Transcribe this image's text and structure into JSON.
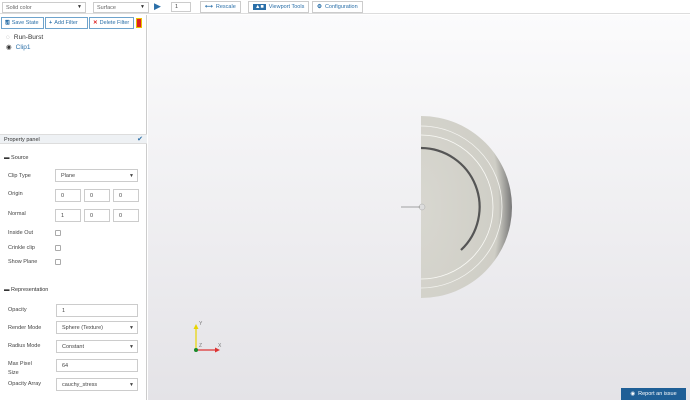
{
  "toolbar": {
    "color_select": "Solid color",
    "repr_select": "Surface",
    "frame_value": "1",
    "rescale": "Rescale",
    "viewport_tools": "Viewport Tools",
    "configuration": "Configuration"
  },
  "filters": {
    "save_state": "Save State",
    "add_filter": "Add Filter",
    "delete_filter": "Delete Filter"
  },
  "pipeline": [
    {
      "label": "Run-Burst"
    },
    {
      "label": "Clip1"
    }
  ],
  "panel": {
    "title": "Property panel",
    "source": {
      "title": "Source",
      "clip_type_label": "Clip Type",
      "clip_type": "Plane",
      "origin_label": "Origin",
      "origin": [
        "0",
        "0",
        "0"
      ],
      "normal_label": "Normal",
      "normal": [
        "1",
        "0",
        "0"
      ],
      "inside_out": "Inside Out",
      "crinkle": "Crinkle clip",
      "show_plane": "Show Plane"
    },
    "representation": {
      "title": "Representation",
      "opacity_label": "Opacity",
      "opacity": "1",
      "render_mode_label": "Render Mode",
      "render_mode": "Sphere (Texture)",
      "radius_mode_label": "Radius Mode",
      "radius_mode": "Constant",
      "max_pixel_label": "Max Pixel Size",
      "max_pixel": "64",
      "opacity_array_label": "Opacity Array",
      "opacity_array": "cauchy_stress"
    }
  },
  "axes": {
    "x": "X",
    "y": "Y",
    "z": "Z"
  },
  "report": "Report an issue"
}
